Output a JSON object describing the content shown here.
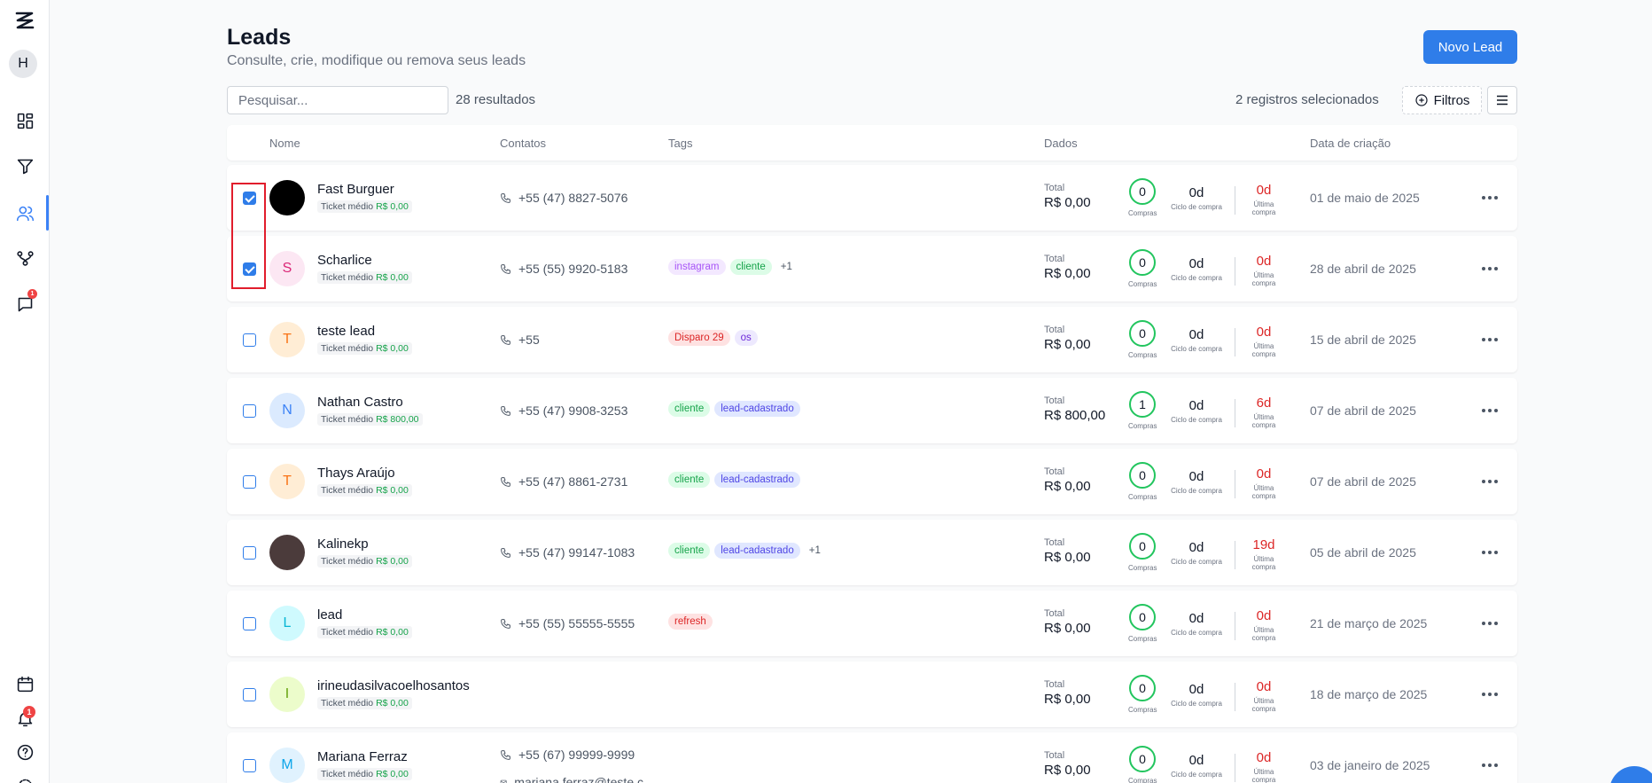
{
  "sidebar": {
    "avatar_initial": "H",
    "chat_badge": "1",
    "notification_badge": "1"
  },
  "header": {
    "title": "Leads",
    "subtitle": "Consulte, crie, modifique ou remova seus leads",
    "new_button": "Novo Lead"
  },
  "toolbar": {
    "search_placeholder": "Pesquisar...",
    "results": "28 resultados",
    "selected": "2 registros selecionados",
    "filter_label": "Filtros"
  },
  "columns": {
    "name": "Nome",
    "contacts": "Contatos",
    "tags": "Tags",
    "data": "Dados",
    "created": "Data de criação"
  },
  "labels": {
    "ticket": "Ticket médio",
    "total": "Total",
    "purchases": "Compras",
    "cycle": "Ciclo de compra",
    "last_line1": "Última",
    "last_line2": "compra"
  },
  "leads": [
    {
      "name": "Fast Burguer",
      "initial": "",
      "ticket": "R$ 0,00",
      "phone": "+55 (47) 8827-5076",
      "email": "",
      "tags": [],
      "more_tags": "",
      "total": "R$ 0,00",
      "purchases": "0",
      "cycle": "0d",
      "last": "0d",
      "date": "01 de maio de 2025",
      "checked": true
    },
    {
      "name": "Scharlice",
      "initial": "S",
      "ticket": "R$ 0,00",
      "phone": "+55 (55) 9920-5183",
      "email": "",
      "tags": [
        "instagram",
        "cliente"
      ],
      "more_tags": "+1",
      "total": "R$ 0,00",
      "purchases": "0",
      "cycle": "0d",
      "last": "0d",
      "date": "28 de abril de 2025",
      "checked": true
    },
    {
      "name": "teste lead",
      "initial": "T",
      "ticket": "R$ 0,00",
      "phone": "+55",
      "email": "",
      "tags": [
        "Disparo 29",
        "os"
      ],
      "more_tags": "",
      "total": "R$ 0,00",
      "purchases": "0",
      "cycle": "0d",
      "last": "0d",
      "date": "15 de abril de 2025",
      "checked": false
    },
    {
      "name": "Nathan Castro",
      "initial": "N",
      "ticket": "R$ 800,00",
      "phone": "+55 (47) 9908-3253",
      "email": "",
      "tags": [
        "cliente",
        "lead-cadastrado"
      ],
      "more_tags": "",
      "total": "R$ 800,00",
      "purchases": "1",
      "cycle": "0d",
      "last": "6d",
      "date": "07 de abril de 2025",
      "checked": false
    },
    {
      "name": "Thays Araújo",
      "initial": "T",
      "ticket": "R$ 0,00",
      "phone": "+55 (47) 8861-2731",
      "email": "",
      "tags": [
        "cliente",
        "lead-cadastrado"
      ],
      "more_tags": "",
      "total": "R$ 0,00",
      "purchases": "0",
      "cycle": "0d",
      "last": "0d",
      "date": "07 de abril de 2025",
      "checked": false
    },
    {
      "name": "Kalinekp",
      "initial": "",
      "ticket": "R$ 0,00",
      "phone": "+55 (47) 99147-1083",
      "email": "",
      "tags": [
        "cliente",
        "lead-cadastrado"
      ],
      "more_tags": "+1",
      "total": "R$ 0,00",
      "purchases": "0",
      "cycle": "0d",
      "last": "19d",
      "date": "05 de abril de 2025",
      "checked": false
    },
    {
      "name": "lead",
      "initial": "L",
      "ticket": "R$ 0,00",
      "phone": "+55 (55) 55555-5555",
      "email": "",
      "tags": [
        "refresh"
      ],
      "more_tags": "",
      "total": "R$ 0,00",
      "purchases": "0",
      "cycle": "0d",
      "last": "0d",
      "date": "21 de março de 2025",
      "checked": false
    },
    {
      "name": "irineudasilvacoelhosantos",
      "initial": "I",
      "ticket": "R$ 0,00",
      "phone": "",
      "email": "",
      "tags": [],
      "more_tags": "",
      "total": "R$ 0,00",
      "purchases": "0",
      "cycle": "0d",
      "last": "0d",
      "date": "18 de março de 2025",
      "checked": false
    },
    {
      "name": "Mariana Ferraz",
      "initial": "M",
      "ticket": "R$ 0,00",
      "phone": "+55 (67) 99999-9999",
      "email": "mariana.ferraz@teste.c",
      "tags": [],
      "more_tags": "",
      "total": "R$ 0,00",
      "purchases": "0",
      "cycle": "0d",
      "last": "0d",
      "date": "03 de janeiro de 2025",
      "checked": false
    }
  ],
  "colors": {
    "accent": "#2f7de9",
    "success": "#22c55e",
    "danger": "#dc2626",
    "highlight": "#e11d2c"
  }
}
